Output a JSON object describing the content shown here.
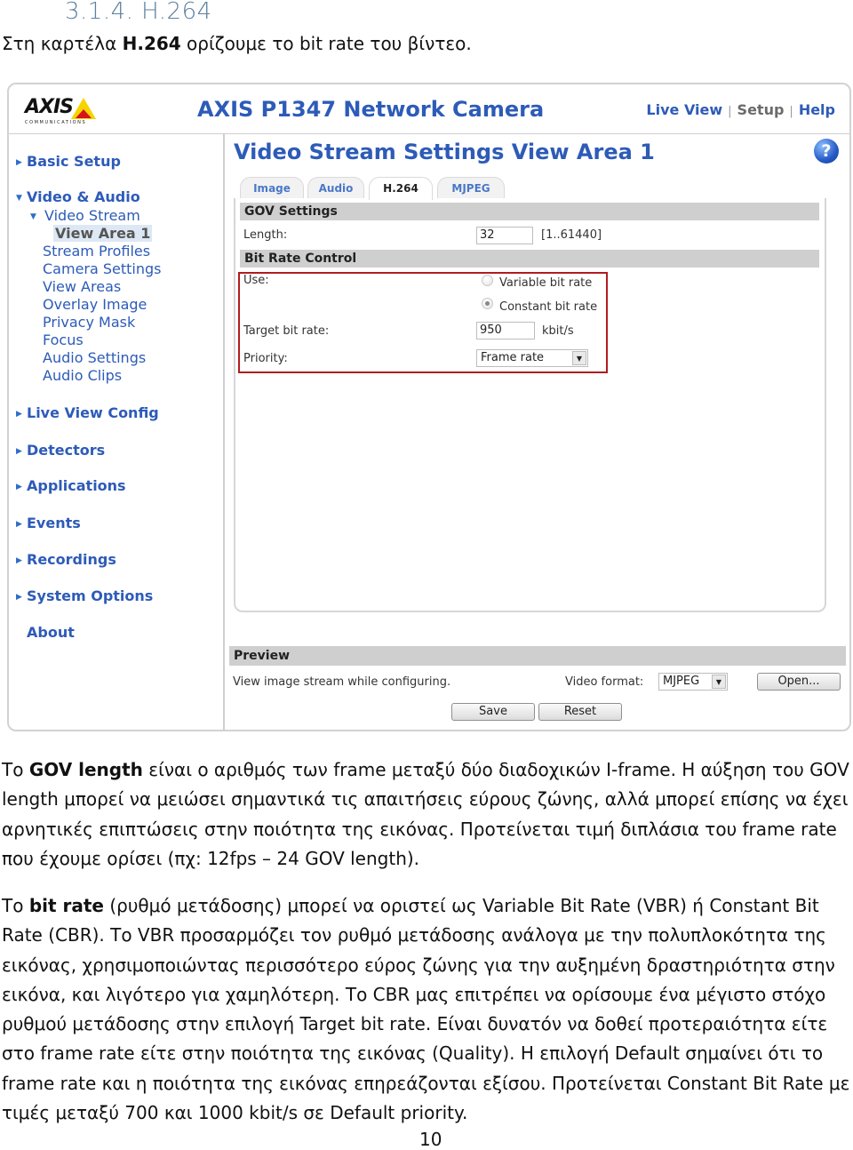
{
  "document": {
    "heading": "3.1.4. H.264",
    "intro": {
      "before": "Στη καρτέλα ",
      "bold": "H.264",
      "after": " ορίζουμε το bit rate του βίντεο."
    },
    "paragraph1": {
      "before": "Το ",
      "bold": "GOV length",
      "after": " είναι ο αριθμός των frame μεταξύ δύο διαδοχικών I-frame. Η αύξηση του GOV length μπορεί να μειώσει σημαντικά τις απαιτήσεις εύρους ζώνης, αλλά μπορεί επίσης να έχει αρνητικές επιπτώσεις στην ποιότητα της εικόνας. Προτείνεται τιμή διπλάσια του frame rate που έχουμε ορίσει (πχ: 12fps – 24 GOV length)."
    },
    "paragraph2": {
      "before": "Το ",
      "bold": "bit rate",
      "after": " (ρυθμό μετάδοσης) μπορεί να οριστεί ως Variable Bit Rate (VBR) ή Constant Bit Rate (CBR). Το VBR προσαρμόζει τον ρυθμό μετάδοσης ανάλογα με την πολυπλοκότητα της εικόνας, χρησιμοποιώντας περισσότερο εύρος ζώνης για την αυξημένη δραστηριότητα στην εικόνα, και λιγότερο για χαμηλότερη. Το CBR μας επιτρέπει να ορίσουμε ένα μέγιστο στόχο ρυθμού μετάδοσης στην επιλογή Target bit rate. Είναι δυνατόν να δοθεί προτεραιότητα είτε στο frame rate είτε στην ποιότητα της εικόνας (Quality). Η επιλογή Default σημαίνει ότι το frame rate και η ποιότητα της εικόνας επηρεάζονται εξίσου. Προτείνεται Constant Bit Rate με τιμές μεταξύ 700 και 1000 kbit/s σε Default priority."
    },
    "page_number": "10"
  },
  "screenshot": {
    "logo": {
      "word": "AXIS",
      "sub": "COMMUNICATIONS"
    },
    "camera_title": "AXIS P1347 Network Camera",
    "top_links": {
      "live_view": "Live View",
      "setup": "Setup",
      "help": "Help",
      "separator": "|"
    },
    "sidebar": {
      "basic_setup": "Basic Setup",
      "video_audio": "Video & Audio",
      "video_stream": "Video Stream",
      "view_area_1": "View Area 1",
      "sub_items": [
        "Stream Profiles",
        "Camera Settings",
        "View Areas",
        "Overlay Image",
        "Privacy Mask",
        "Focus",
        "Audio Settings",
        "Audio Clips"
      ],
      "sections": [
        "Live View Config",
        "Detectors",
        "Applications",
        "Events",
        "Recordings",
        "System Options"
      ],
      "about": "About",
      "arrow_right": "▶",
      "arrow_down": "▼"
    },
    "content_title": "Video Stream Settings View Area 1",
    "help_icon": "?",
    "tabs": [
      "Image",
      "Audio",
      "H.264",
      "MJPEG"
    ],
    "active_tab": "H.264",
    "gov": {
      "section": "GOV Settings",
      "length_label": "Length:",
      "length_value": "32",
      "length_range": "[1..61440]"
    },
    "bitrate": {
      "section": "Bit Rate Control",
      "use_label": "Use:",
      "option_vbr": "Variable bit rate",
      "option_cbr": "Constant bit rate",
      "selected": "Constant bit rate",
      "target_label": "Target bit rate:",
      "target_value": "950",
      "target_unit": "kbit/s",
      "priority_label": "Priority:",
      "priority_value": "Frame rate"
    },
    "preview": {
      "section": "Preview",
      "description": "View image stream while configuring.",
      "format_label": "Video format:",
      "format_value": "MJPEG",
      "open_button": "Open..."
    },
    "buttons": {
      "save": "Save",
      "reset": "Reset"
    },
    "colors": {
      "link_blue": "#2d5bb8",
      "highlight_red": "#b01c22",
      "section_gray": "#cfcfcf"
    }
  }
}
